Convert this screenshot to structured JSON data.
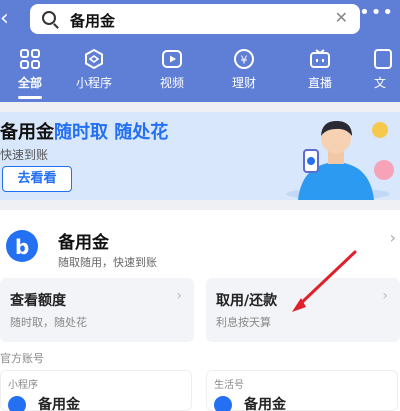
{
  "header": {
    "back_icon": "chevron-left-icon",
    "search_query": "备用金",
    "clear_icon": "close-icon",
    "more_icon": "more-icon"
  },
  "tabs": [
    {
      "label": "全部",
      "icon": "grid-icon",
      "active": true
    },
    {
      "label": "小程序",
      "icon": "miniapp-icon"
    },
    {
      "label": "视频",
      "icon": "play-icon"
    },
    {
      "label": "理财",
      "icon": "yen-icon"
    },
    {
      "label": "直播",
      "icon": "tv-icon"
    },
    {
      "label": "文",
      "icon": "doc-icon"
    }
  ],
  "banner": {
    "title_prefix": "备用金",
    "title_highlight": "随时取 随处花",
    "subtitle": "快速到账",
    "button": "去看看"
  },
  "service": {
    "name": "备用金",
    "description": "随取随用，快速到账",
    "actions": [
      {
        "title": "查看额度",
        "desc": "随时取，随处花"
      },
      {
        "title": "取用/还款",
        "desc": "利息按天算"
      }
    ]
  },
  "official_section_label": "官方账号",
  "accounts": [
    {
      "type": "小程序",
      "name": "备用金"
    },
    {
      "type": "生活号",
      "name": "备用金"
    }
  ],
  "colors": {
    "brand_blue": "#2470f2",
    "header_bg": "#5f7ed6",
    "annotation_red": "#e0202a"
  }
}
